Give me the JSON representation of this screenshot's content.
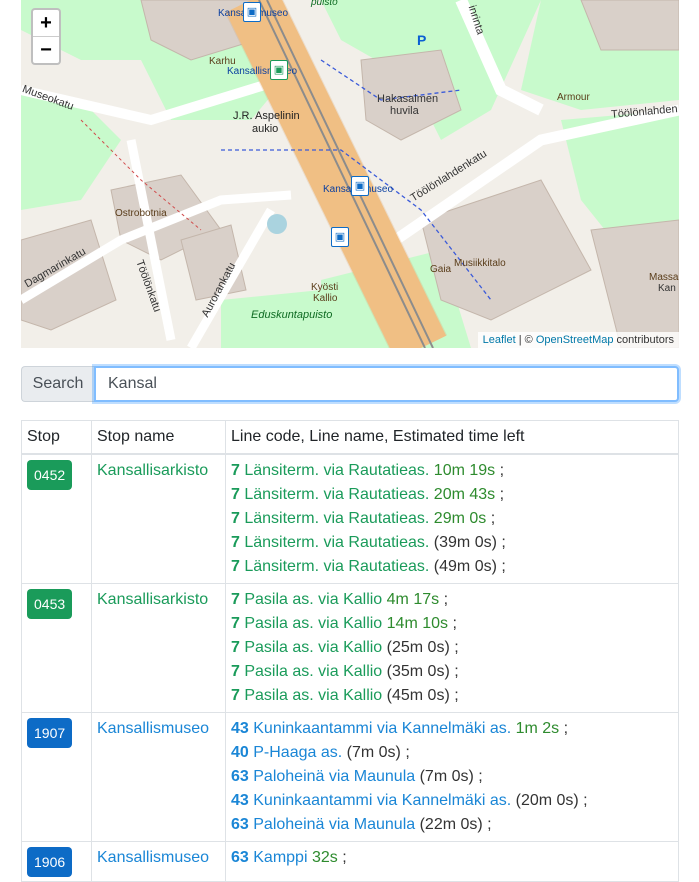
{
  "map": {
    "zoom_in": "+",
    "zoom_out": "−",
    "labels": {
      "museokatu": "Museokatu",
      "kansallismuseo_top": "Kansallismuseo",
      "kansallismuseo_2": "Kansallismuseo",
      "kansallismuseo_3": "Kansallismuseo",
      "karhu": "Karhu",
      "jr_line1": "J.R. Aspelinin",
      "jr_line2": "aukio",
      "hakasalmen1": "Hakasalmen",
      "hakasalmen2": "huvila",
      "armour": "Armour",
      "toolonlahdenkatu": "Töölönlahdenkatu",
      "toolonlahden_short": "Töölönlahden",
      "ostrobotnia": "Ostrobotnia",
      "runeberginkatu": "Dagmarinkatu",
      "toolonkatu": "Töölönkatu",
      "aurorankatu": "Aurorankatu",
      "kyosti1": "Kyösti",
      "kyosti2": "Kallio",
      "eduskuntapuisto": "Eduskuntapuisto",
      "gaia": "Gaia",
      "musiikkitalo": "Musiikkitalo",
      "massa": "Massa",
      "kan": "Kan",
      "puisto": "puisto",
      "mannerheimintie": "inrinta",
      "p": "P"
    },
    "attribution": {
      "leaflet": "Leaflet",
      "sep": " | © ",
      "osm": "OpenStreetMap",
      "contributors": " contributors"
    },
    "colors": {
      "road_main": "#f9c88d",
      "park": "#c8facc",
      "building": "#d9d0c9",
      "tram_track": "#8c8c8c"
    }
  },
  "search": {
    "label": "Search",
    "value": "Kansal"
  },
  "table": {
    "headers": [
      "Stop",
      "Stop name",
      "Line code, Line name, Estimated time left"
    ],
    "rows": [
      {
        "stop": "0452",
        "name": "Kansallisarkisto",
        "color": "green",
        "departures": [
          {
            "code": "7",
            "line": "Länsiterm. via Rautatieas.",
            "time": "10m 19s",
            "realtime": true,
            "sep": " ;"
          },
          {
            "code": "7",
            "line": "Länsiterm. via Rautatieas.",
            "time": "20m 43s",
            "realtime": true,
            "sep": " ;"
          },
          {
            "code": "7",
            "line": "Länsiterm. via Rautatieas.",
            "time": "29m 0s",
            "realtime": true,
            "sep": " ;"
          },
          {
            "code": "7",
            "line": "Länsiterm. via Rautatieas.",
            "time": "(39m 0s)",
            "realtime": false,
            "sep": " ;"
          },
          {
            "code": "7",
            "line": "Länsiterm. via Rautatieas.",
            "time": "(49m 0s)",
            "realtime": false,
            "sep": " ;"
          }
        ]
      },
      {
        "stop": "0453",
        "name": "Kansallisarkisto",
        "color": "green",
        "departures": [
          {
            "code": "7",
            "line": "Pasila as. via Kallio",
            "time": "4m 17s",
            "realtime": true,
            "sep": " ;"
          },
          {
            "code": "7",
            "line": "Pasila as. via Kallio",
            "time": "14m 10s",
            "realtime": true,
            "sep": " ;"
          },
          {
            "code": "7",
            "line": "Pasila as. via Kallio",
            "time": "(25m 0s)",
            "realtime": false,
            "sep": " ;"
          },
          {
            "code": "7",
            "line": "Pasila as. via Kallio",
            "time": "(35m 0s)",
            "realtime": false,
            "sep": " ;"
          },
          {
            "code": "7",
            "line": "Pasila as. via Kallio",
            "time": "(45m 0s)",
            "realtime": false,
            "sep": " ;"
          }
        ]
      },
      {
        "stop": "1907",
        "name": "Kansallismuseo",
        "color": "blue",
        "departures": [
          {
            "code": "43",
            "line": "Kuninkaantammi via Kannelmäki as.",
            "time": "1m 2s",
            "realtime": true,
            "sep": " ;"
          },
          {
            "code": "40",
            "line": "P-Haaga as.",
            "time": "(7m 0s)",
            "realtime": false,
            "sep": " ;"
          },
          {
            "code": "63",
            "line": "Paloheinä via Maunula",
            "time": "(7m 0s)",
            "realtime": false,
            "sep": " ;"
          },
          {
            "code": "43",
            "line": "Kuninkaantammi via Kannelmäki as.",
            "time": "(20m 0s)",
            "realtime": false,
            "sep": " ;"
          },
          {
            "code": "63",
            "line": "Paloheinä via Maunula",
            "time": "(22m 0s)",
            "realtime": false,
            "sep": " ;"
          }
        ]
      },
      {
        "stop": "1906",
        "name": "Kansallismuseo",
        "color": "blue",
        "departures": [
          {
            "code": "63",
            "line": "Kamppi",
            "time": "32s",
            "realtime": true,
            "sep": " ;"
          }
        ]
      }
    ]
  }
}
